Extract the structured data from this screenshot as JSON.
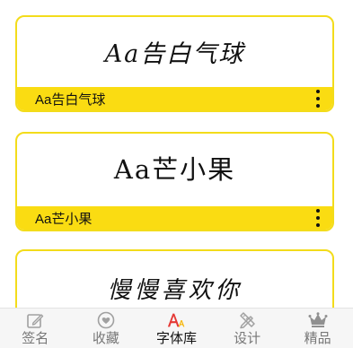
{
  "fonts": [
    {
      "preview": "Aa告白气球",
      "label": "Aa告白气球"
    },
    {
      "preview": "Aa芒小果",
      "label": "Aa芒小果"
    },
    {
      "preview": "慢慢喜欢你",
      "label": ""
    }
  ],
  "tabs": [
    {
      "label": "签名",
      "icon": "edit-icon",
      "active": false
    },
    {
      "label": "收藏",
      "icon": "heart-icon",
      "active": false
    },
    {
      "label": "字体库",
      "icon": "font-library-icon",
      "active": true
    },
    {
      "label": "设计",
      "icon": "design-tools-icon",
      "active": false
    },
    {
      "label": "精品",
      "icon": "crown-icon",
      "active": false
    }
  ],
  "colors": {
    "accent_yellow": "#fadc12",
    "card_border": "#f3dc1b",
    "active_icon_red": "#e53935",
    "inactive_icon": "#9e9e9e"
  }
}
